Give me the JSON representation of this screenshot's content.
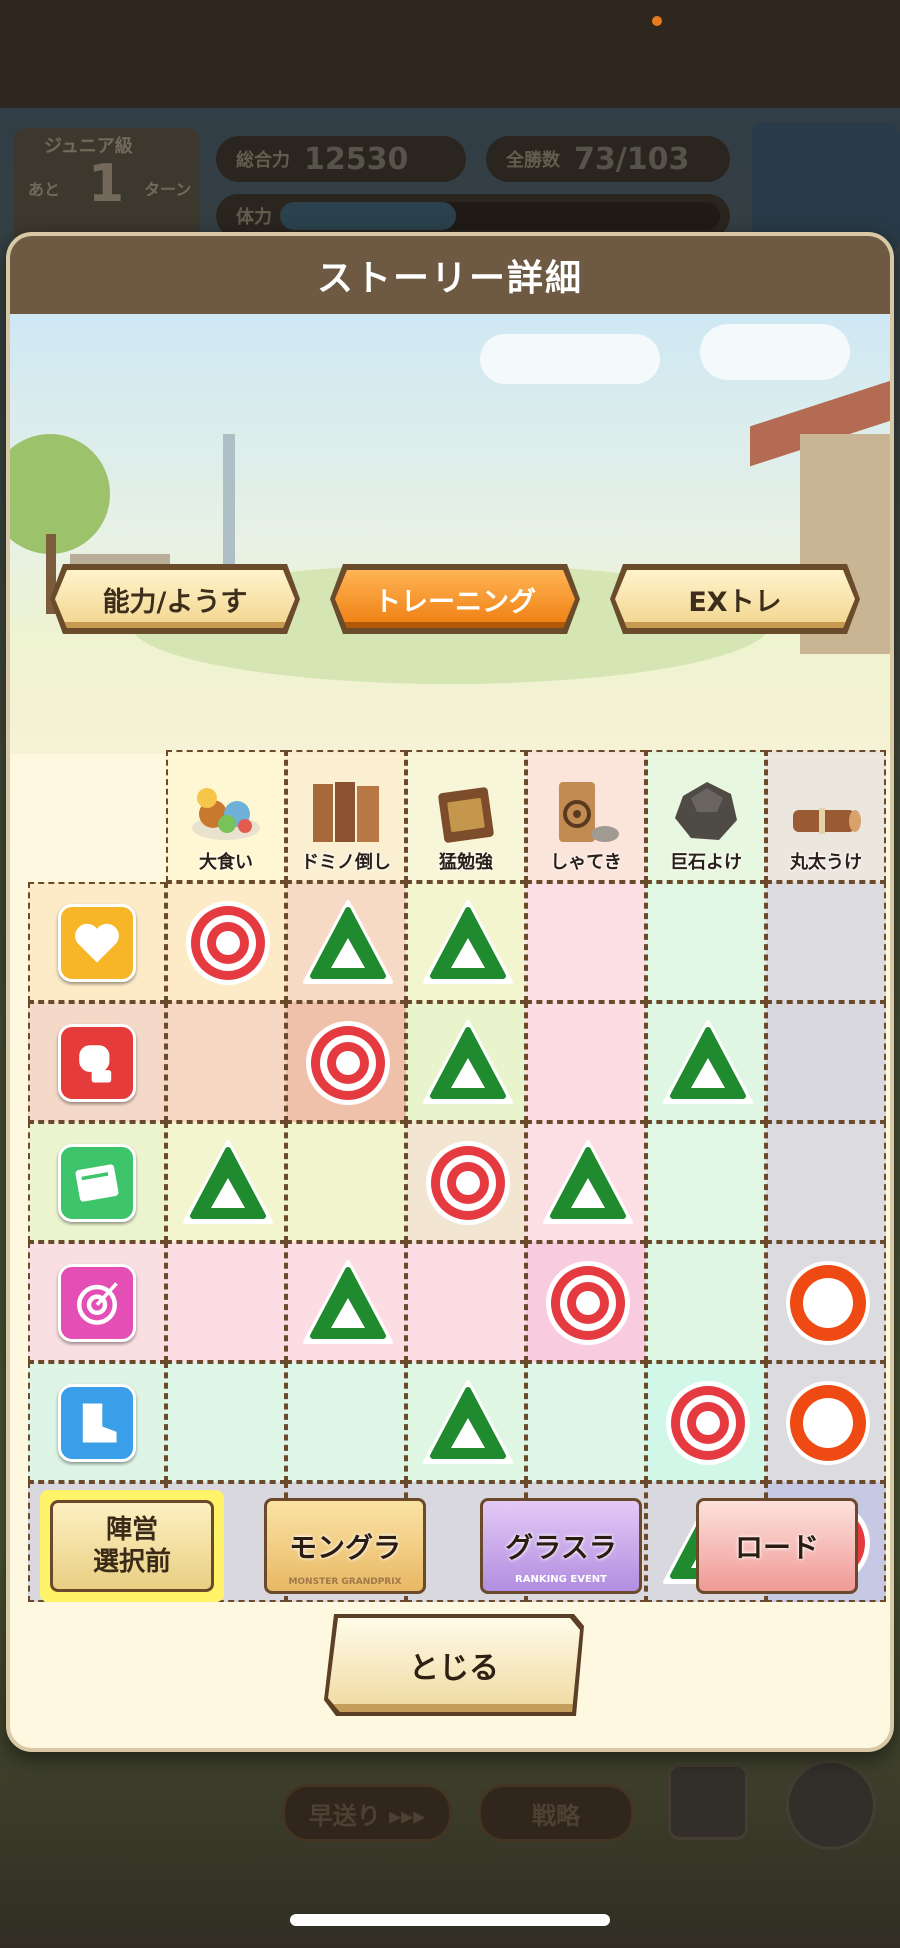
{
  "background": {
    "hud": {
      "rank_label": "ジュニア級",
      "rank_prefix": "あと",
      "rank_number": "1",
      "rank_suffix": "ターン",
      "total_power_label": "総合力",
      "total_power_value": "12530",
      "wins_label": "全勝数",
      "wins_value": "73/103",
      "stamina_label": "体力",
      "stamina_level": 0.4
    },
    "bottom_buttons": [
      "早送り ▸▸▸",
      "戦略"
    ]
  },
  "modal": {
    "title": "ストーリー詳細",
    "tabs": [
      {
        "label": "能力/ようす",
        "active": false
      },
      {
        "label": "トレーニング",
        "active": true
      },
      {
        "label": "EXトレ",
        "active": false
      }
    ],
    "columns": [
      {
        "label": "大食い",
        "icon": "food-plate-icon"
      },
      {
        "label": "ドミノ倒し",
        "icon": "domino-boards-icon"
      },
      {
        "label": "猛勉強",
        "icon": "book-icon"
      },
      {
        "label": "しゃてき",
        "icon": "target-board-icon"
      },
      {
        "label": "巨石よけ",
        "icon": "boulder-icon"
      },
      {
        "label": "丸太うけ",
        "icon": "log-icon"
      }
    ],
    "rows": [
      {
        "icon": "heart-icon",
        "color": "#f7b528",
        "tint": "#fdebc8",
        "marks": [
          "double-circle",
          "triangle",
          "triangle",
          "",
          "",
          ""
        ]
      },
      {
        "icon": "boxing-glove-icon",
        "color": "#e53b3b",
        "tint": "#f5d9c8",
        "marks": [
          "",
          "double-circle",
          "triangle",
          "",
          "triangle",
          ""
        ]
      },
      {
        "icon": "book-icon",
        "color": "#3ec46b",
        "tint": "#ecf4cf",
        "marks": [
          "triangle",
          "",
          "double-circle",
          "triangle",
          "",
          ""
        ]
      },
      {
        "icon": "target-icon",
        "color": "#e34fb5",
        "tint": "#f9dfe2",
        "marks": [
          "",
          "triangle",
          "",
          "double-circle",
          "",
          "circle"
        ]
      },
      {
        "icon": "boot-icon",
        "color": "#3a9ee8",
        "tint": "#def5e6",
        "marks": [
          "",
          "",
          "triangle",
          "",
          "double-circle",
          "circle"
        ]
      },
      {
        "icon": "shield-icon",
        "color": "#3d62d6",
        "tint": "#d9d8de",
        "marks": [
          "",
          "",
          "",
          "triangle",
          "triangle",
          "double-circle"
        ]
      }
    ],
    "cell_tints": [
      [
        "#fdebc8",
        "#f7dac6",
        "#f3f5cf",
        "#fbdfe4",
        "#e0f7e3",
        "#dcdbe0"
      ],
      [
        "#f6d7c4",
        "#efc0aa",
        "#eaf4cc",
        "#fbdde3",
        "#def6e2",
        "#d9d8de"
      ],
      [
        "#f3f5cf",
        "#f0f5cb",
        "#f2e6d3",
        "#fbdfe4",
        "#e0f7e3",
        "#dcdbe0"
      ],
      [
        "#fbdde3",
        "#fbdde3",
        "#fbdde3",
        "#f8cbdf",
        "#def6e2",
        "#dcdbe0"
      ],
      [
        "#def6e6",
        "#def6e6",
        "#def6e2",
        "#def6e6",
        "#d0f7e8",
        "#dcdbe0"
      ],
      [
        "#d9d8de",
        "#d9d8de",
        "#d9d8de",
        "#d9d8de",
        "#d9d8de",
        "#c7c8e4"
      ]
    ],
    "bottom": {
      "faction_line1": "陣営",
      "faction_line2": "選択前",
      "modes": [
        {
          "label": "モングラ",
          "sub": "MONSTER GRANDPRIX",
          "color_top": "#fbe3a5",
          "color_bottom": "#e8b864"
        },
        {
          "label": "グラスラ",
          "sub": "RANKING EVENT",
          "color_top": "#e4c9f5",
          "color_bottom": "#b28ee0"
        },
        {
          "label": "ロード",
          "sub": "",
          "color_top": "#fde1dc",
          "color_bottom": "#f09a96"
        }
      ],
      "close_label": "とじる"
    }
  }
}
